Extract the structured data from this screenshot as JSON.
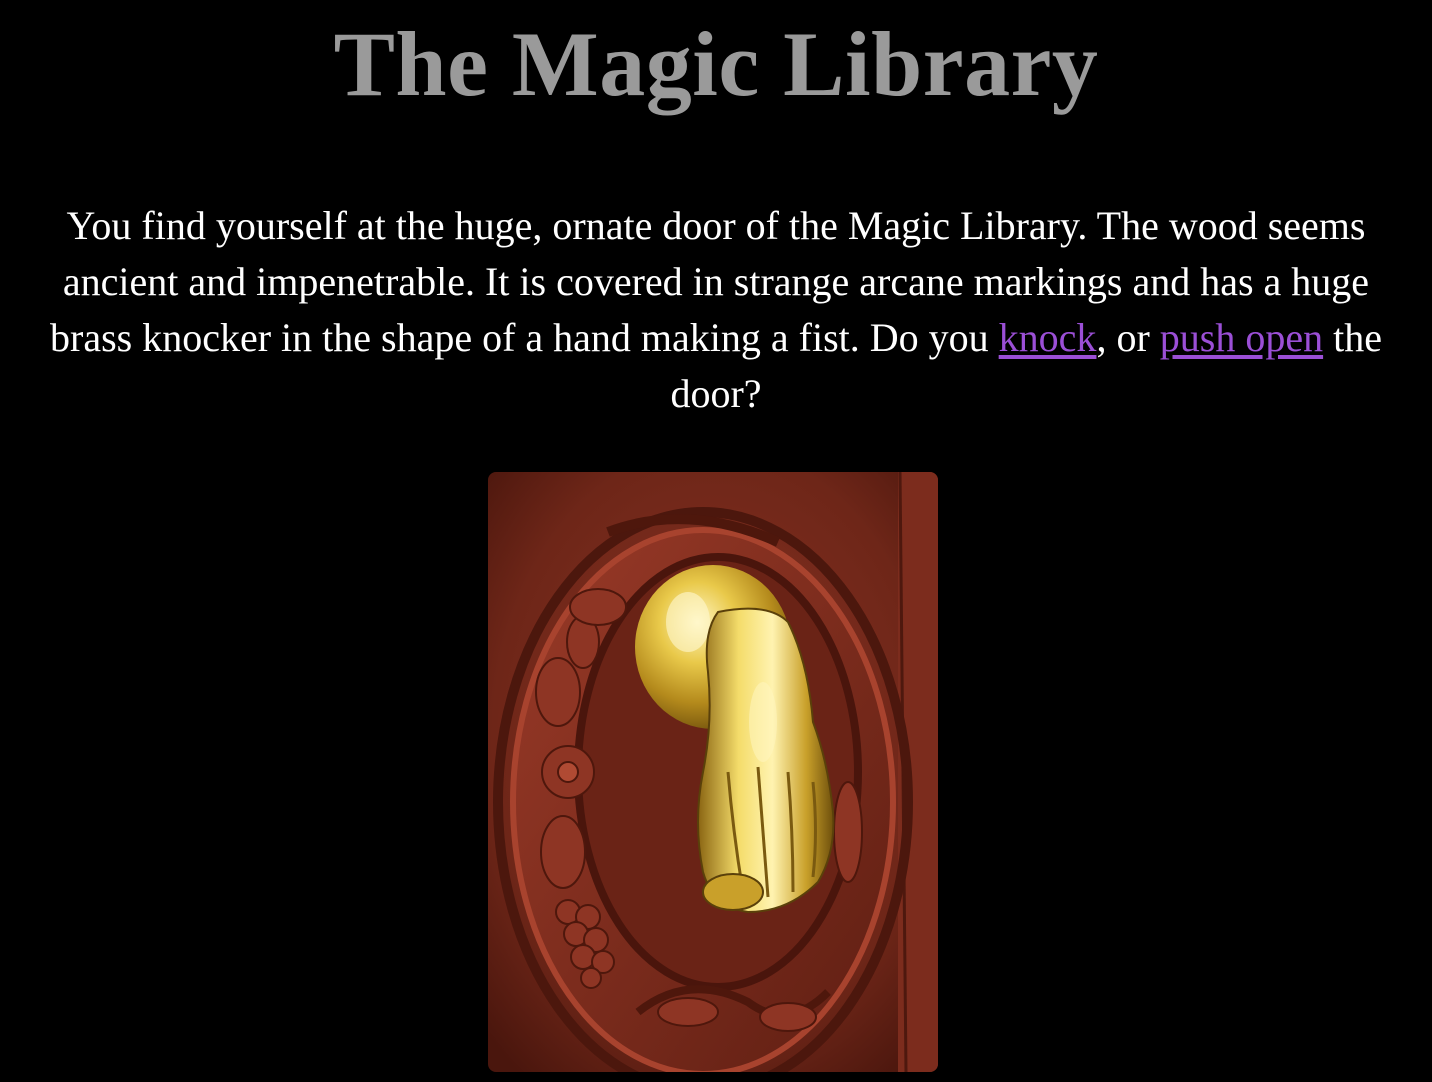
{
  "page": {
    "title": "The Magic Library",
    "story": {
      "before": "You find yourself at the huge, ornate door of the Magic Library. The wood seems ancient and impenetrable. It is covered in strange arcane markings and has a huge brass knocker in the shape of a hand making a fist. Do you ",
      "link_knock": "knock",
      "between": ", or ",
      "link_push": "push open",
      "after": " the door?"
    },
    "image": {
      "subject": "door-knocker-photo",
      "colors": {
        "wood": "#7a2a1c",
        "brass": "#d8b63a",
        "link": "#9b4fd6",
        "title": "#9a9a9a"
      }
    }
  }
}
